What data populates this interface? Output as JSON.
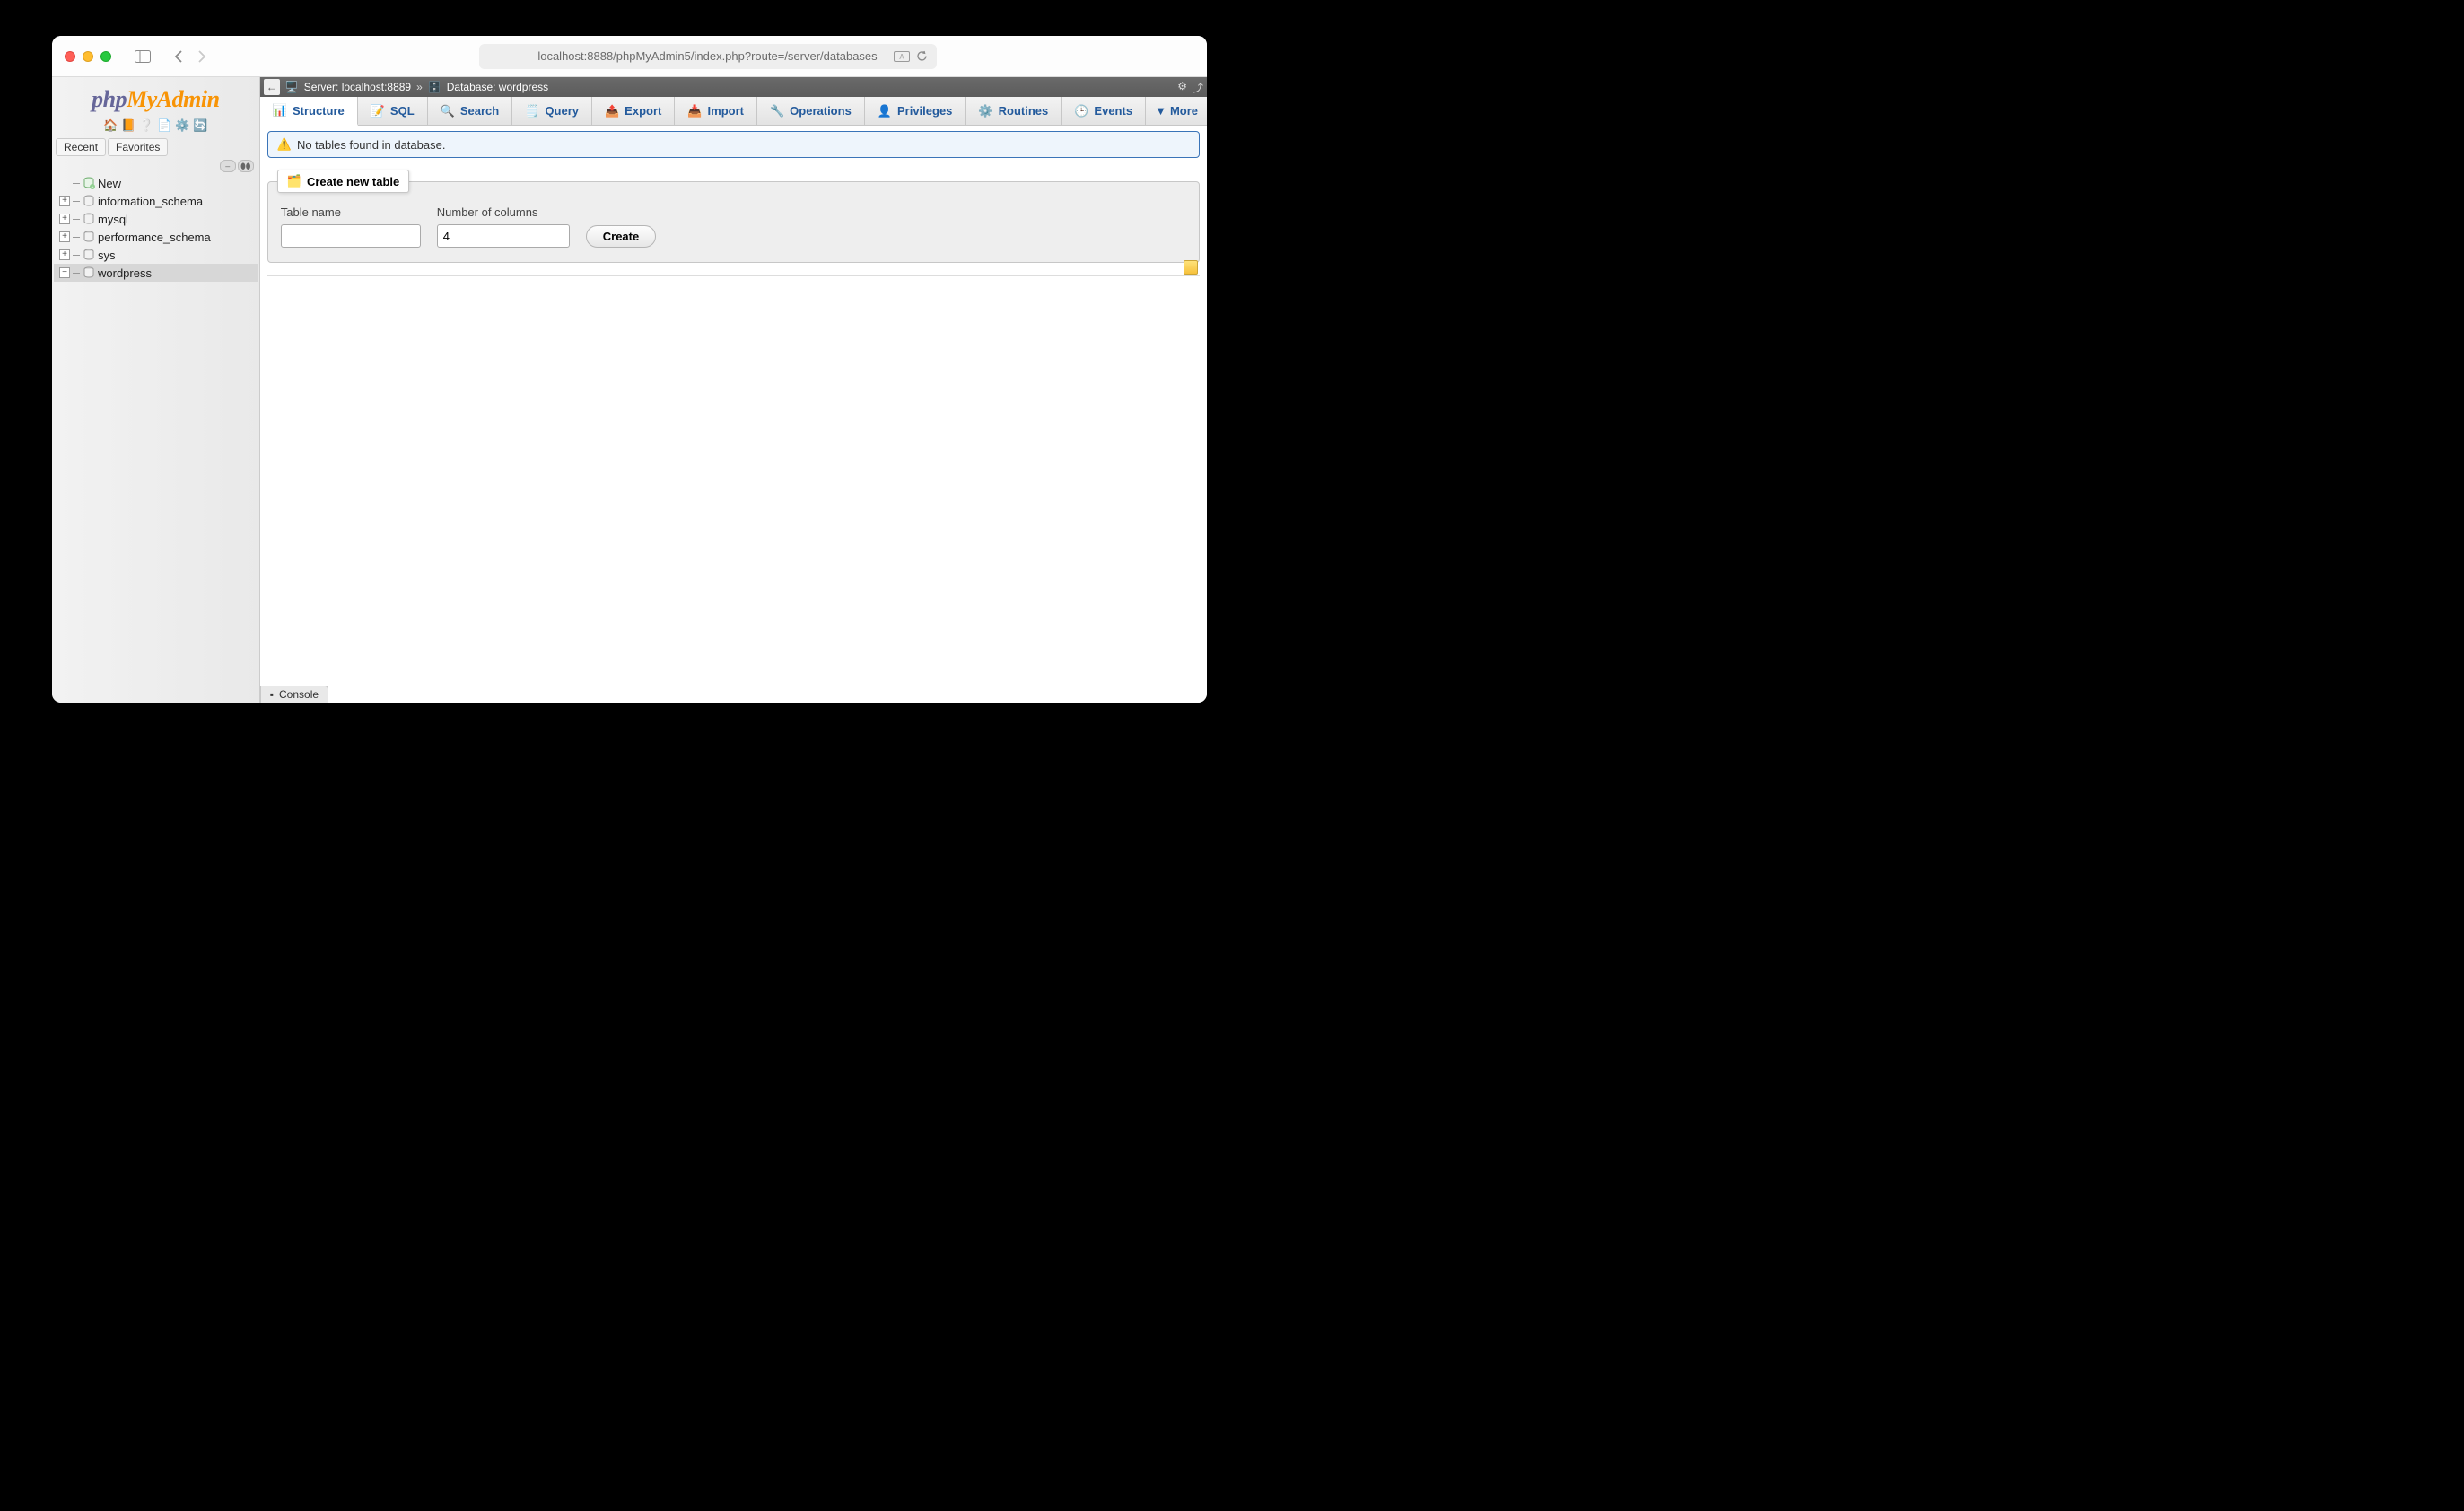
{
  "browser": {
    "url": "localhost:8888/phpMyAdmin5/index.php?route=/server/databases"
  },
  "logo": {
    "part1": "php",
    "part2": "MyAdmin"
  },
  "sidebar": {
    "tabs": {
      "recent": "Recent",
      "favorites": "Favorites"
    },
    "new_label": "New",
    "databases": [
      {
        "name": "information_schema"
      },
      {
        "name": "mysql"
      },
      {
        "name": "performance_schema"
      },
      {
        "name": "sys"
      },
      {
        "name": "wordpress"
      }
    ]
  },
  "breadcrumb": {
    "server_label": "Server: localhost:8889",
    "database_label": "Database: wordpress"
  },
  "tabs": {
    "structure": "Structure",
    "sql": "SQL",
    "search": "Search",
    "query": "Query",
    "export": "Export",
    "import": "Import",
    "operations": "Operations",
    "privileges": "Privileges",
    "routines": "Routines",
    "events": "Events",
    "more": "More"
  },
  "notice": {
    "text": "No tables found in database."
  },
  "create_table": {
    "legend": "Create new table",
    "name_label": "Table name",
    "name_value": "",
    "cols_label": "Number of columns",
    "cols_value": "4",
    "button": "Create"
  },
  "console": {
    "label": "Console"
  }
}
